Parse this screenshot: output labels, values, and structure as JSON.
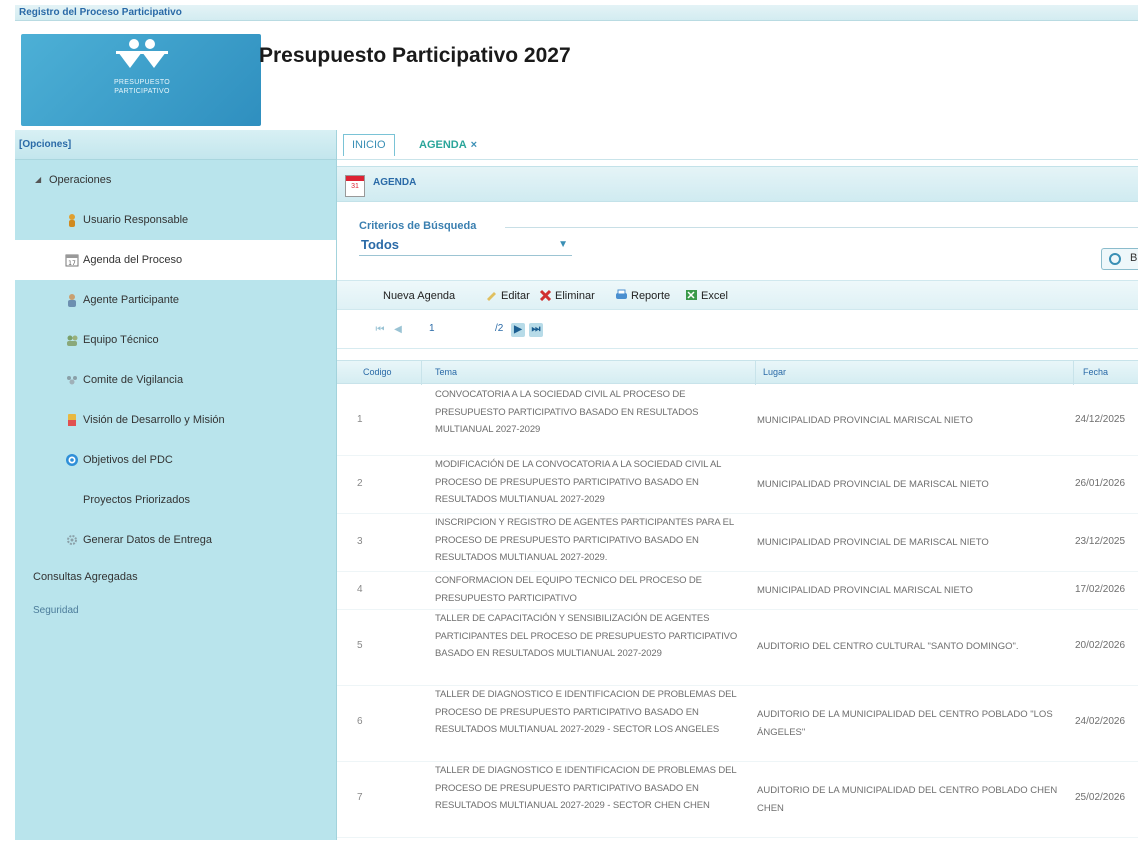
{
  "window": {
    "title": "Registro del Proceso Participativo"
  },
  "header": {
    "logo_text_line1": "PRESUPUESTO",
    "logo_text_line2": "PARTICIPATIVO",
    "title": "Presupuesto Participativo 2027"
  },
  "sidebar": {
    "header": "[Opciones]",
    "root": "Operaciones",
    "items": [
      {
        "label": "Usuario Responsable",
        "icon": "user-icon"
      },
      {
        "label": "Agenda del Proceso",
        "icon": "calendar-icon",
        "active": true
      },
      {
        "label": "Agente Participante",
        "icon": "person-icon"
      },
      {
        "label": "Equipo Técnico",
        "icon": "team-icon"
      },
      {
        "label": "Comite de Vigilancia",
        "icon": "committee-icon"
      },
      {
        "label": "Visión de Desarrollo y Misión",
        "icon": "vision-icon"
      },
      {
        "label": "Objetivos del PDC",
        "icon": "target-icon"
      },
      {
        "label": "Proyectos Priorizados",
        "icon": ""
      },
      {
        "label": "Generar Datos de Entrega",
        "icon": "gear-icon"
      }
    ],
    "sections": [
      "Consultas Agregadas",
      "Seguridad"
    ]
  },
  "tabs": {
    "inicio": "INICIO",
    "agenda": "AGENDA",
    "close": "×"
  },
  "panel": {
    "calendar_glyph": "31",
    "title": "AGENDA"
  },
  "search": {
    "legend": "Criterios de Búsqueda",
    "selected": "Todos",
    "button_label": "B"
  },
  "toolbar": {
    "new": "Nueva Agenda",
    "edit": "Editar",
    "delete": "Eliminar",
    "report": "Reporte",
    "excel": "Excel"
  },
  "pager": {
    "current": "1",
    "of": "/2"
  },
  "table": {
    "headers": {
      "code": "Codigo",
      "tema": "Tema",
      "lugar": "Lugar",
      "fecha": "Fecha"
    },
    "rows": [
      {
        "code": "1",
        "tema": "CONVOCATORIA A LA SOCIEDAD CIVIL AL PROCESO DE PRESUPUESTO PARTICIPATIVO BASADO EN RESULTADOS MULTIANUAL 2027-2029",
        "lugar": "MUNICIPALIDAD PROVINCIAL MARISCAL NIETO",
        "fecha": "24/12/2025"
      },
      {
        "code": "2",
        "tema": "MODIFICACIÓN DE LA CONVOCATORIA A LA SOCIEDAD CIVIL AL PROCESO DE PRESUPUESTO PARTICIPATIVO BASADO EN RESULTADOS MULTIANUAL 2027-2029",
        "lugar": "MUNICIPALIDAD PROVINCIAL DE MARISCAL NIETO",
        "fecha": "26/01/2026"
      },
      {
        "code": "3",
        "tema": "INSCRIPCION Y REGISTRO DE AGENTES PARTICIPANTES PARA EL PROCESO DE PRESUPUESTO PARTICIPATIVO BASADO EN RESULTADOS MULTIANUAL 2027-2029.",
        "lugar": "MUNICIPALIDAD PROVINCIAL DE MARISCAL NIETO",
        "fecha": "23/12/2025"
      },
      {
        "code": "4",
        "tema": "CONFORMACION DEL EQUIPO TECNICO DEL PROCESO DE PRESUPUESTO PARTICIPATIVO",
        "lugar": "MUNICIPALIDAD PROVINCIAL MARISCAL NIETO",
        "fecha": "17/02/2026"
      },
      {
        "code": "5",
        "tema": "TALLER DE CAPACITACIÓN Y SENSIBILIZACIÓN DE AGENTES PARTICIPANTES DEL PROCESO DE PRESUPUESTO PARTICIPATIVO BASADO EN RESULTADOS MULTIANUAL 2027-2029",
        "lugar": "AUDITORIO DEL CENTRO CULTURAL \"SANTO DOMINGO\".",
        "fecha": "20/02/2026"
      },
      {
        "code": "6",
        "tema": "TALLER DE DIAGNOSTICO E IDENTIFICACION DE PROBLEMAS DEL PROCESO DE PRESUPUESTO PARTICIPATIVO BASADO EN RESULTADOS MULTIANUAL 2027-2029 - SECTOR LOS ANGELES",
        "lugar": "AUDITORIO DE LA MUNICIPALIDAD DEL CENTRO POBLADO \"LOS ÁNGELES\"",
        "fecha": "24/02/2026"
      },
      {
        "code": "7",
        "tema": "TALLER DE DIAGNOSTICO E IDENTIFICACION DE PROBLEMAS DEL PROCESO DE PRESUPUESTO PARTICIPATIVO BASADO EN RESULTADOS MULTIANUAL 2027-2029 - SECTOR CHEN CHEN",
        "lugar": "AUDITORIO DE LA MUNICIPALIDAD DEL CENTRO POBLADO CHEN CHEN",
        "fecha": "25/02/2026"
      }
    ]
  }
}
